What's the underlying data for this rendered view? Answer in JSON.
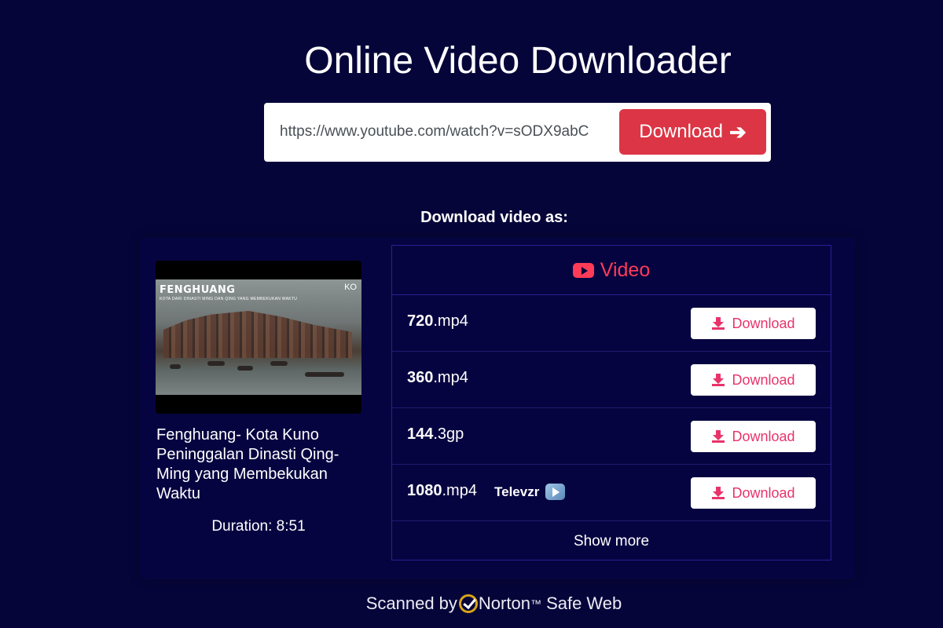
{
  "page": {
    "title": "Online Video Downloader"
  },
  "search": {
    "url_value": "https://www.youtube.com/watch?v=sODX9abC",
    "download_label": "Download",
    "download_icon": "arrow-right-icon"
  },
  "section": {
    "heading": "Download video as:"
  },
  "video": {
    "thumbnail_title": "FENGHUANG",
    "thumbnail_subtitle": "KOTA DARI DINASTI MING DAN QING YANG MEMBEKUKAN WAKTU",
    "thumbnail_logo": "KO",
    "title": "Fenghuang- Kota Kuno Peninggalan Dinasti Qing-Ming yang Membekukan Waktu",
    "duration": "Duration: 8:51"
  },
  "table": {
    "header_label": "Video",
    "header_icon": "youtube-icon",
    "rows": [
      {
        "quality": "720",
        "ext": ".mp4",
        "button": "Download"
      },
      {
        "quality": "360",
        "ext": ".mp4",
        "button": "Download"
      },
      {
        "quality": "144",
        "ext": ".3gp",
        "button": "Download"
      },
      {
        "quality": "1080",
        "ext": ".mp4",
        "button": "Download",
        "extra": "Televzr"
      }
    ],
    "show_more": "Show more"
  },
  "footer": {
    "prefix": "Scanned by",
    "brand": "Norton",
    "tm": "™",
    "suffix": " Safe Web"
  },
  "colors": {
    "background": "#06053a",
    "accent_red": "#dc3545",
    "link_pink": "#e8336b",
    "youtube_red": "#ff3b57",
    "norton_gold": "#d8a319"
  }
}
